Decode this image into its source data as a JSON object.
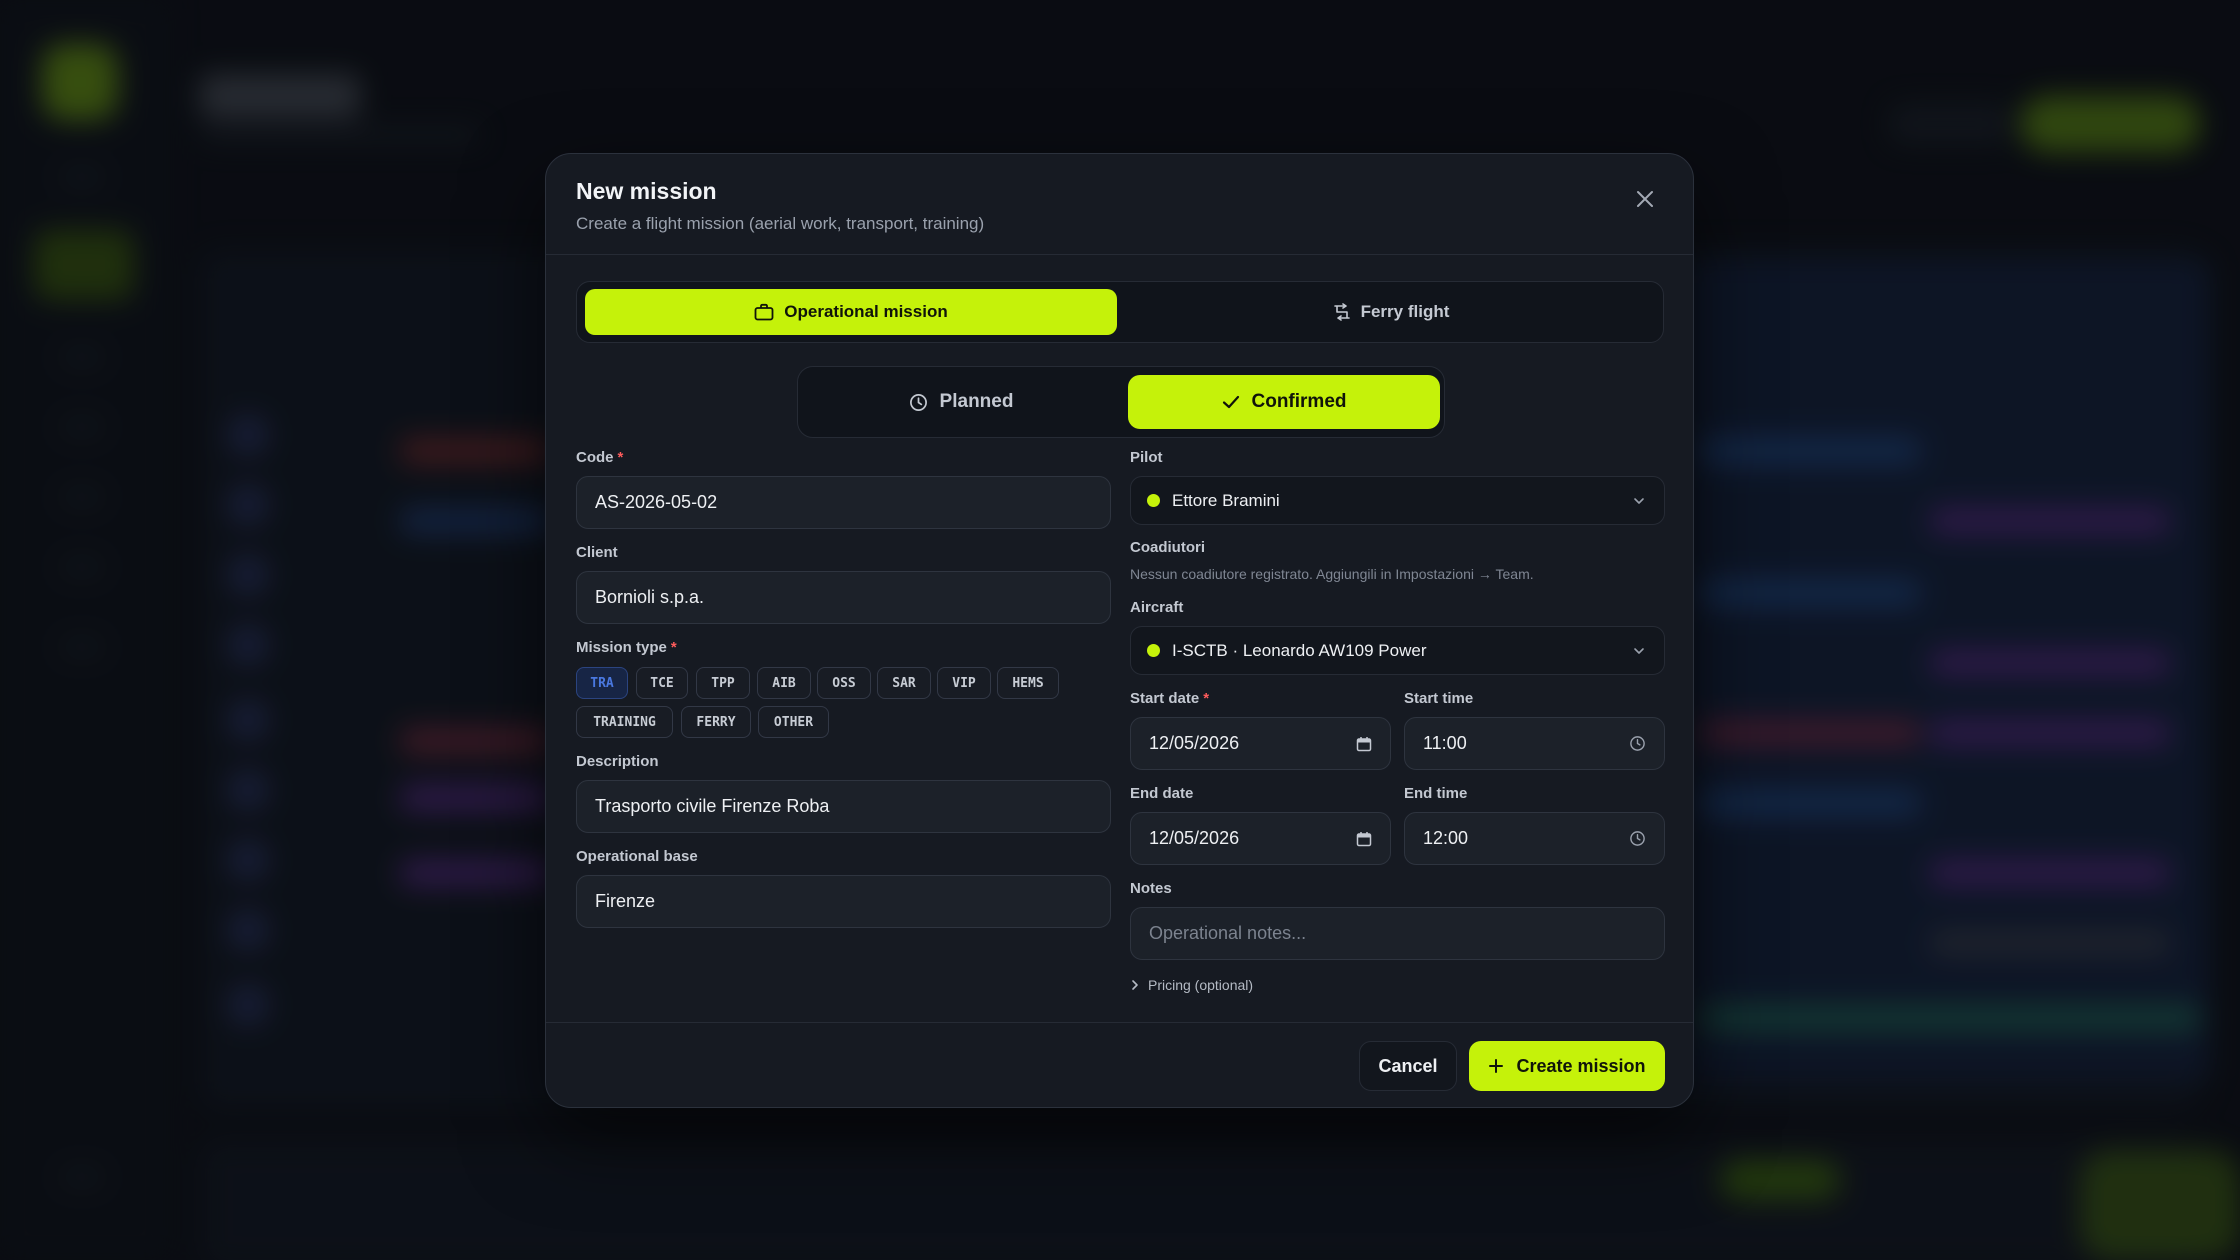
{
  "modal": {
    "title": "New mission",
    "subtitle": "Create a flight mission (aerial work, transport, training)"
  },
  "mission_kind": {
    "options": [
      "Operational mission",
      "Ferry flight"
    ],
    "selected": "Operational mission"
  },
  "status": {
    "options": [
      "Planned",
      "Confirmed"
    ],
    "selected": "Confirmed"
  },
  "form": {
    "code": {
      "label": "Code",
      "value": "AS-2026-05-02",
      "required": true
    },
    "client": {
      "label": "Client",
      "value": "Bornioli s.p.a."
    },
    "mission_type": {
      "label": "Mission type",
      "required": true,
      "options": [
        "TRA",
        "TCE",
        "TPP",
        "AIB",
        "OSS",
        "SAR",
        "VIP",
        "HEMS",
        "TRAINING",
        "FERRY",
        "OTHER"
      ],
      "selected": "TRA"
    },
    "description": {
      "label": "Description",
      "value": "Trasporto civile Firenze Roba"
    },
    "operational_base": {
      "label": "Operational base",
      "value": "Firenze"
    },
    "pilot": {
      "label": "Pilot",
      "value": "Ettore Bramini"
    },
    "coadiutori": {
      "label": "Coadiutori",
      "hint": "Nessun coadiutore registrato. Aggiungili in Impostazioni → Team."
    },
    "aircraft": {
      "label": "Aircraft",
      "value": "I-SCTB · Leonardo AW109 Power"
    },
    "start_date": {
      "label": "Start date",
      "value": "12/05/2026",
      "required": true
    },
    "start_time": {
      "label": "Start time",
      "value": "11:00"
    },
    "end_date": {
      "label": "End date",
      "value": "12/05/2026"
    },
    "end_time": {
      "label": "End time",
      "value": "12:00"
    },
    "notes": {
      "label": "Notes",
      "placeholder": "Operational notes..."
    },
    "pricing_label": "Pricing (optional)"
  },
  "footer": {
    "cancel_label": "Cancel",
    "create_label": "Create mission"
  },
  "colors": {
    "accent": "#c5f20a",
    "modal_bg": "#161a22",
    "required": "#ff5c5c",
    "chip_selected": "#4a78e0"
  }
}
